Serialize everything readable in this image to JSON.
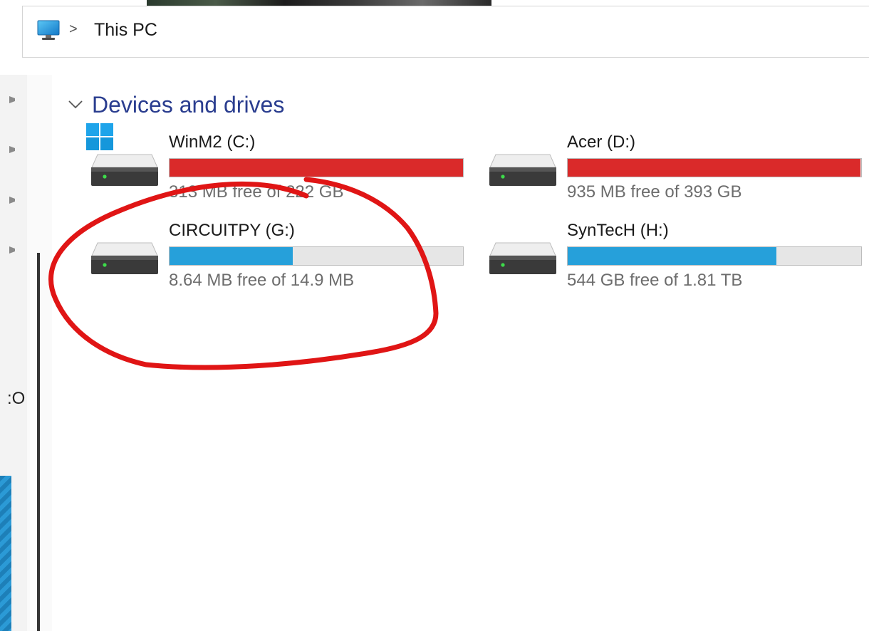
{
  "breadcrumb": {
    "location": "This PC",
    "separator": ">"
  },
  "nav": {
    "partial_text": ":O"
  },
  "section": {
    "title": "Devices and drives"
  },
  "drives": [
    {
      "name": "WinM2 (C:)",
      "free_text": "313 MB free of 222 GB",
      "used_fraction": 0.999,
      "bar_color": "#da2a2a",
      "system_drive": true
    },
    {
      "name": "Acer (D:)",
      "free_text": "935 MB free of 393 GB",
      "used_fraction": 0.998,
      "bar_color": "#da2a2a",
      "system_drive": false
    },
    {
      "name": "CIRCUITPY (G:)",
      "free_text": "8.64 MB free of 14.9 MB",
      "used_fraction": 0.42,
      "bar_color": "#26a0da",
      "system_drive": false
    },
    {
      "name": "SynTecH (H:)",
      "free_text": "544 GB free of 1.81 TB",
      "used_fraction": 0.71,
      "bar_color": "#26a0da",
      "system_drive": false
    }
  ],
  "icons": {
    "pc": "this-pc-icon",
    "drive": "hard-drive-icon",
    "windows": "windows-logo-icon",
    "pin": "pin-icon"
  },
  "colors": {
    "section_title": "#2a3d8f",
    "annotation": "#e01515",
    "critical_bar": "#da2a2a",
    "normal_bar": "#26a0da"
  }
}
